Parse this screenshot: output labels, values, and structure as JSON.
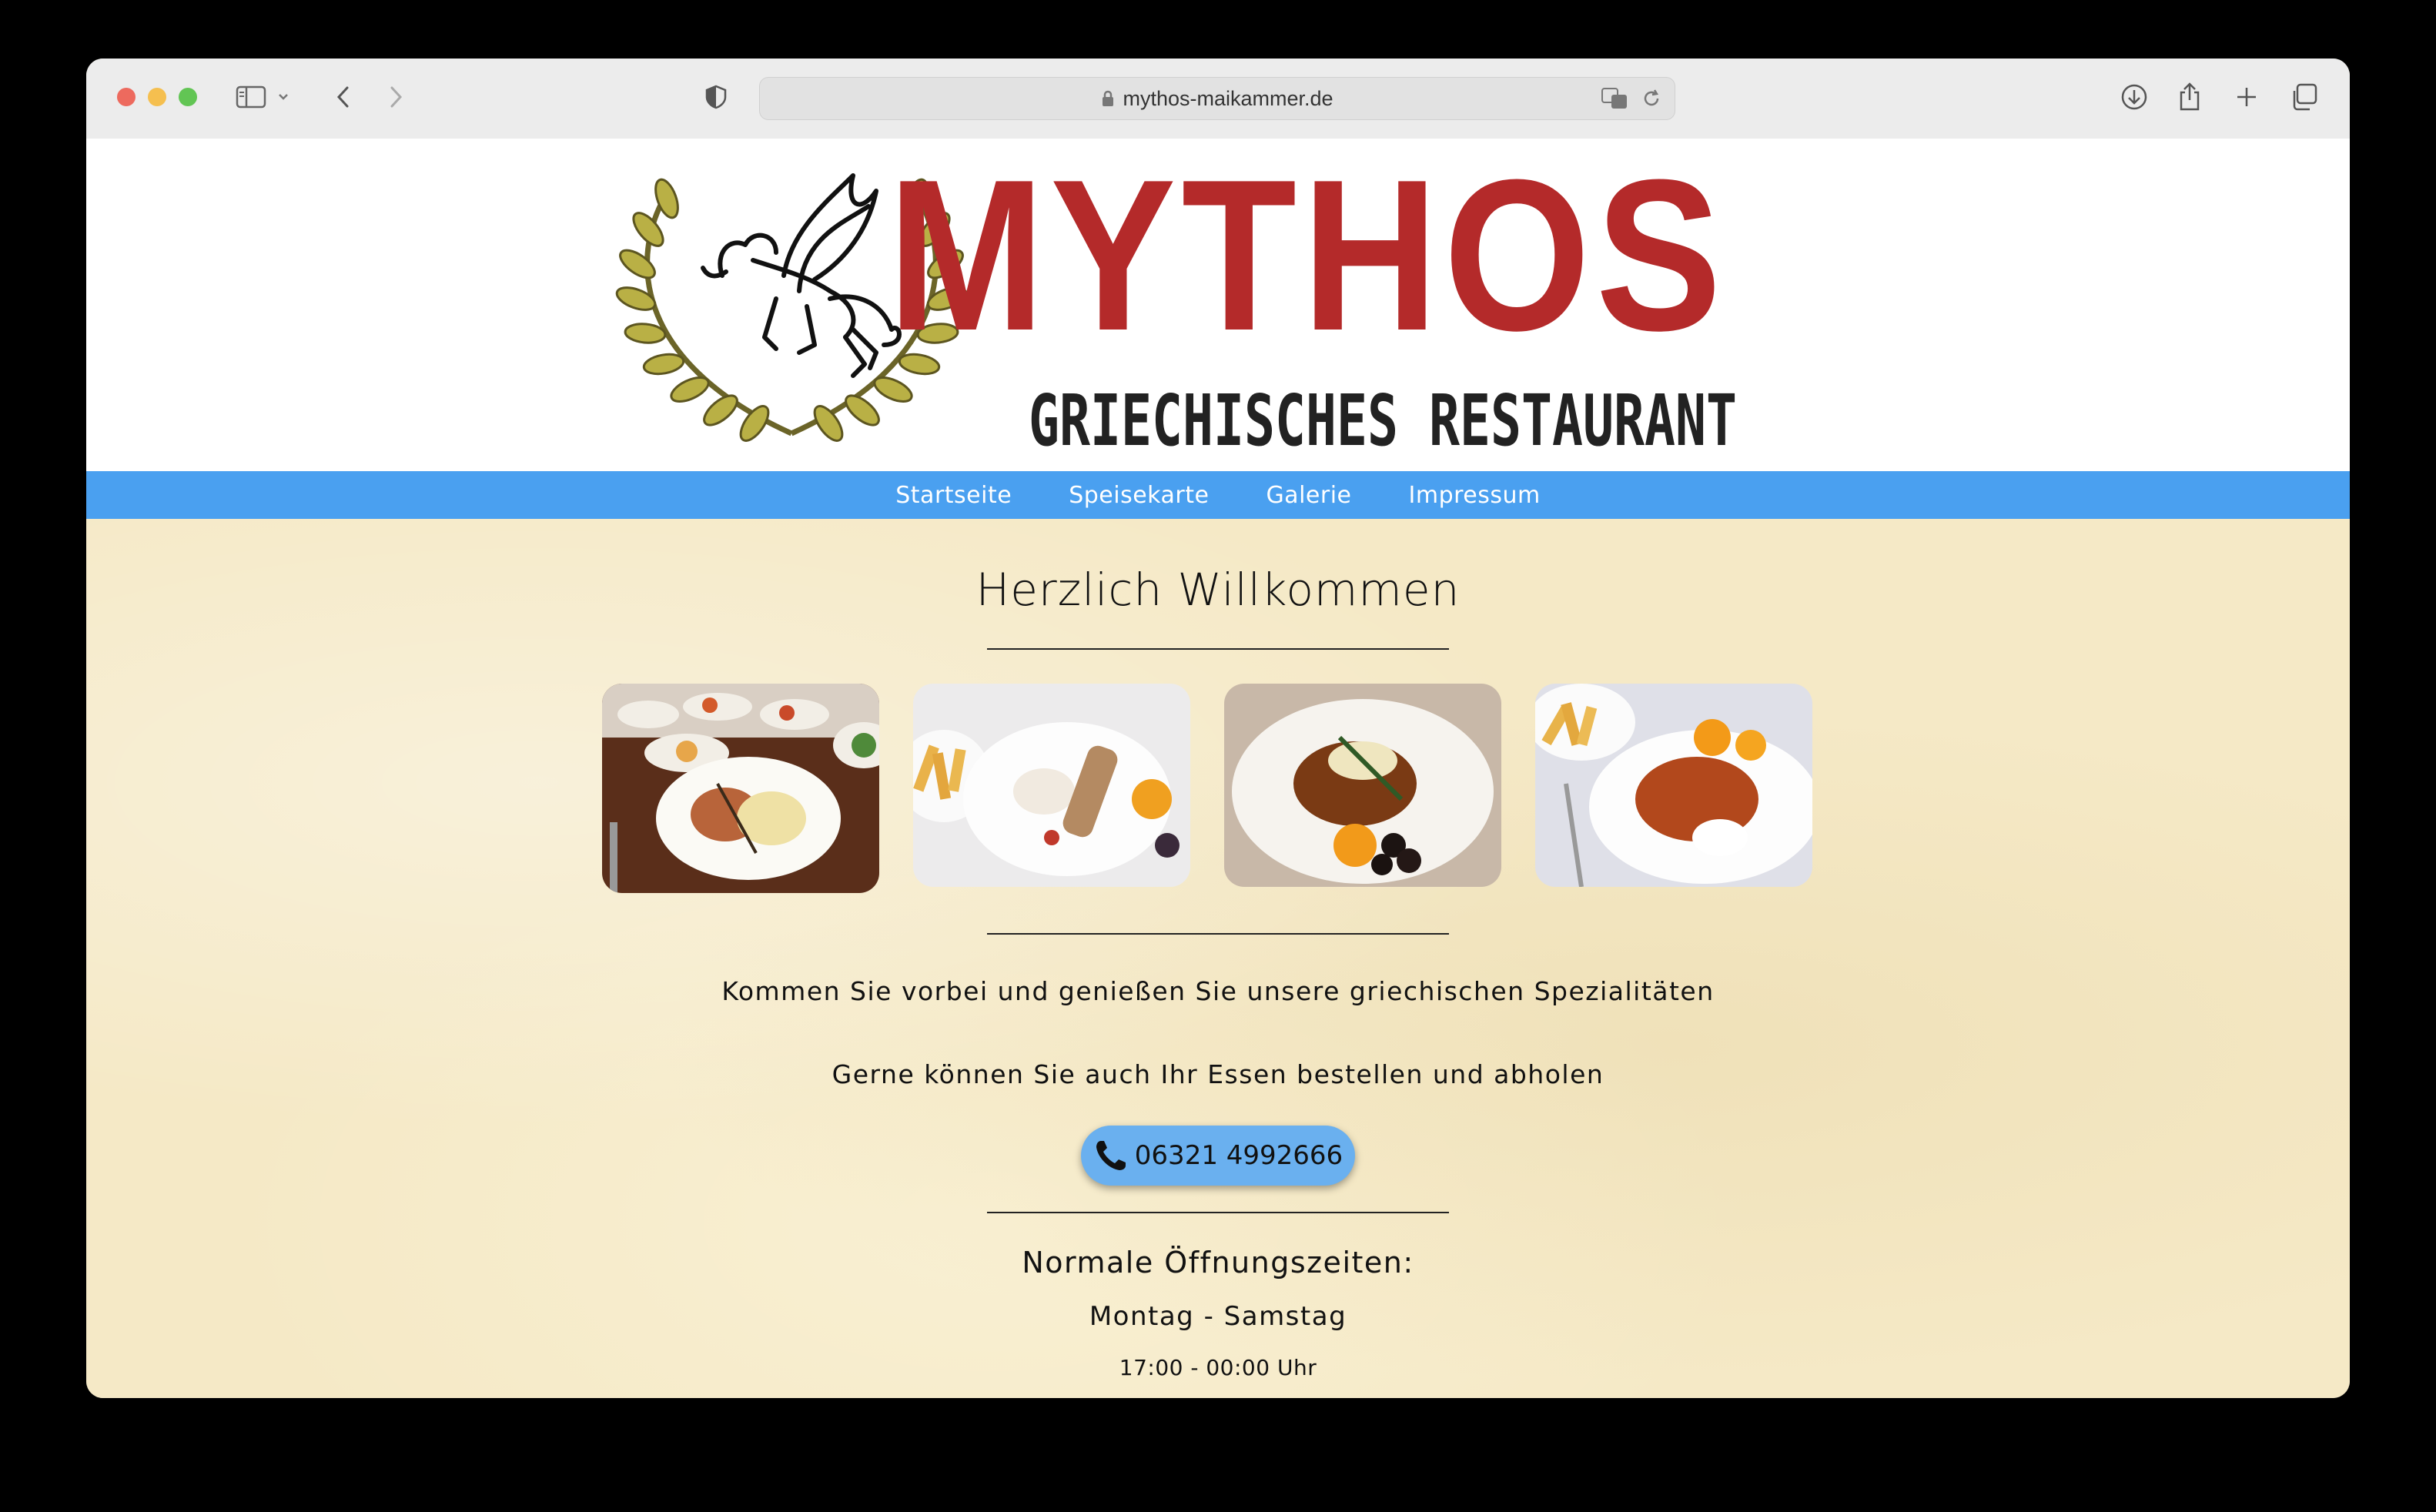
{
  "browser": {
    "url": "mythos-maikammer.de"
  },
  "header": {
    "logo_title": "MYTHOS",
    "logo_subtitle": "GRIECHISCHES RESTAURANT"
  },
  "nav": {
    "items": [
      {
        "label": "Startseite"
      },
      {
        "label": "Speisekarte"
      },
      {
        "label": "Galerie"
      },
      {
        "label": "Impressum"
      }
    ]
  },
  "main": {
    "heading": "Herzlich Willkommen",
    "intro": "Kommen Sie vorbei und genießen Sie unsere griechischen Spezialitäten",
    "order_text": "Gerne können Sie auch Ihr Essen bestellen und abholen",
    "phone": "06321 4992666",
    "hours_title": "Normale Öffnungszeiten:",
    "hours_days": "Montag - Samstag",
    "hours_time": "17:00 - 00:00 Uhr"
  },
  "colors": {
    "nav_bar": "#4aa0f0",
    "phone_button": "#6ab0ef",
    "logo_red": "#b42a2a",
    "background": "#f5e9c6"
  }
}
